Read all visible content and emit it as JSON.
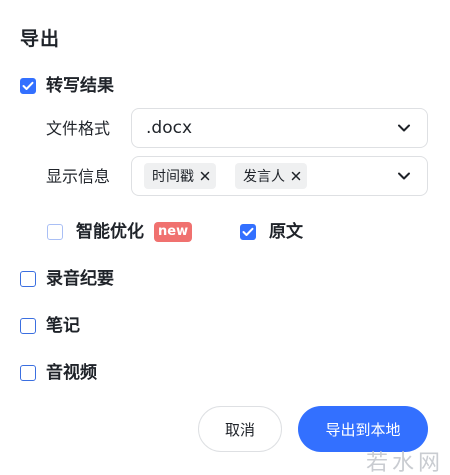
{
  "dialog": {
    "title": "导出"
  },
  "transcript": {
    "label": "转写结果",
    "checked": true,
    "file_format": {
      "label": "文件格式",
      "value": ".docx"
    },
    "display_info": {
      "label": "显示信息",
      "tags": [
        "时间戳",
        "发言人"
      ]
    },
    "options": {
      "smart_optimize": {
        "label": "智能优化",
        "badge": "new",
        "checked": false
      },
      "original": {
        "label": "原文",
        "checked": true
      }
    }
  },
  "recording_summary": {
    "label": "录音纪要",
    "checked": false
  },
  "notes": {
    "label": "笔记",
    "checked": false
  },
  "audio_video": {
    "label": "音视频",
    "checked": false
  },
  "footer": {
    "cancel_label": "取消",
    "export_label": "导出到本地"
  },
  "watermark": "若水网",
  "colors": {
    "primary": "#3370ff",
    "badge": "#f0716f",
    "border": "#dee0e3"
  },
  "icons": {
    "checkmark": "check-icon",
    "chevron": "chevron-down-icon",
    "tag_remove": "close-icon"
  }
}
